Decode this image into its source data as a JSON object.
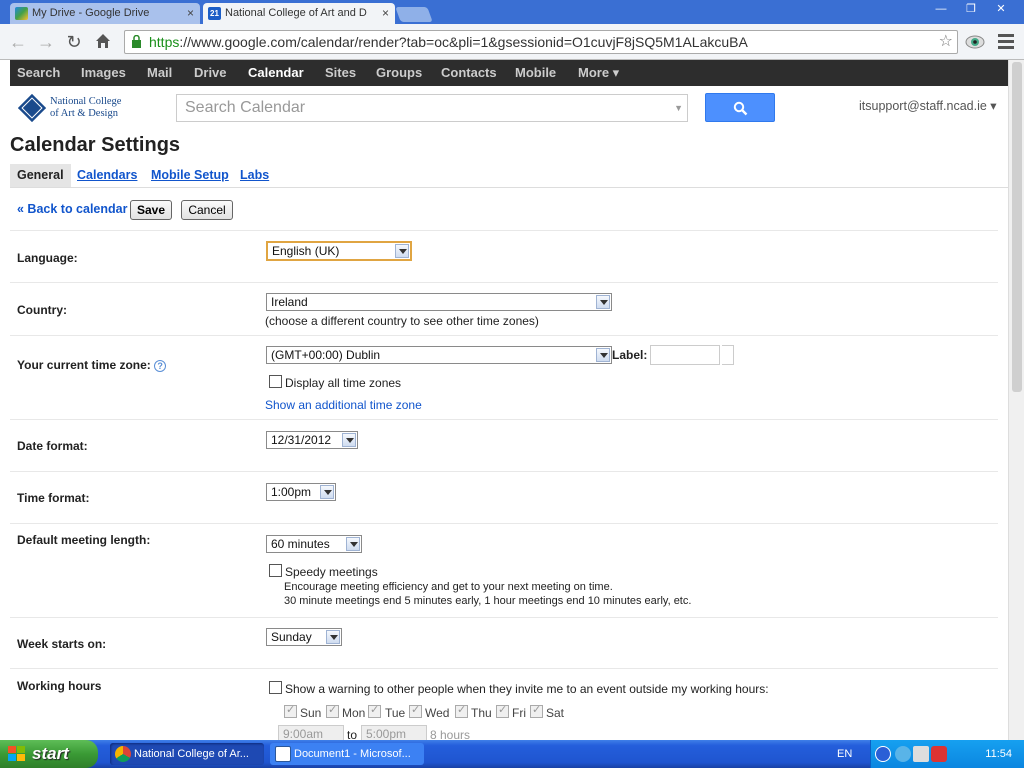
{
  "browser": {
    "tabs": [
      {
        "title": "My Drive - Google Drive",
        "active": false
      },
      {
        "title": "National College of Art and D",
        "active": true
      }
    ],
    "tab2_badge": "21",
    "url_scheme": "https",
    "url_rest": "://www.google.com/calendar/render?tab=oc&pli=1&gsessionid=O1cuvjF8jSQ5M1ALakcuBA",
    "close_glyph": "×"
  },
  "gbar": {
    "items": [
      "Search",
      "Images",
      "Mail",
      "Drive",
      "Calendar",
      "Sites",
      "Groups",
      "Contacts",
      "Mobile",
      "More ▾"
    ],
    "active": "Calendar"
  },
  "header": {
    "logo_line1": "National College",
    "logo_line2": "of Art & Design",
    "search_placeholder": "Search Calendar",
    "account": "itsupport@staff.ncad.ie ▾"
  },
  "page": {
    "title": "Calendar Settings",
    "subtabs": [
      "General",
      "Calendars",
      "Mobile Setup",
      "Labs"
    ],
    "back_link": "« Back to calendar",
    "save": "Save",
    "cancel": "Cancel"
  },
  "settings": {
    "language": {
      "label": "Language:",
      "value": "English (UK)"
    },
    "country": {
      "label": "Country:",
      "value": "Ireland",
      "hint": "(choose a different country to see other time zones)"
    },
    "timezone": {
      "label": "Your current time zone:",
      "help": "?",
      "value": "(GMT+00:00) Dublin",
      "label_field": "Label:",
      "display_all": "Display all time zones",
      "additional": "Show an additional time zone"
    },
    "date_format": {
      "label": "Date format:",
      "value": "12/31/2012"
    },
    "time_format": {
      "label": "Time format:",
      "value": "1:00pm"
    },
    "meeting_length": {
      "label": "Default meeting length:",
      "value": "60 minutes",
      "speedy": "Speedy meetings",
      "speedy_desc1": "Encourage meeting efficiency and get to your next meeting on time.",
      "speedy_desc2": "30 minute meetings end 5 minutes early, 1 hour meetings end 10 minutes early, etc."
    },
    "week_start": {
      "label": "Week starts on:",
      "value": "Sunday"
    },
    "working_hours": {
      "label": "Working hours",
      "warning": "Show a warning to other people when they invite me to an event outside my working hours:",
      "days": [
        "Sun",
        "Mon",
        "Tue",
        "Wed",
        "Thu",
        "Fri",
        "Sat"
      ],
      "start": "9:00am",
      "to": "to",
      "end": "5:00pm",
      "total": "8 hours"
    }
  },
  "taskbar": {
    "start": "start",
    "tasks": [
      "National College of Ar...",
      "Document1 - Microsof..."
    ],
    "lang": "EN",
    "clock": "11:54"
  },
  "colors": {
    "gbar_bg": "#2d2d2d",
    "link": "#1155cc",
    "search_button": "#4d90fe",
    "xp_taskbar": "#245edb",
    "xp_start": "#3a9a35"
  },
  "icons": [
    "lock-icon",
    "star-icon",
    "search-icon",
    "help-icon",
    "chrome-icon",
    "word-icon",
    "windows-flag-icon"
  ]
}
